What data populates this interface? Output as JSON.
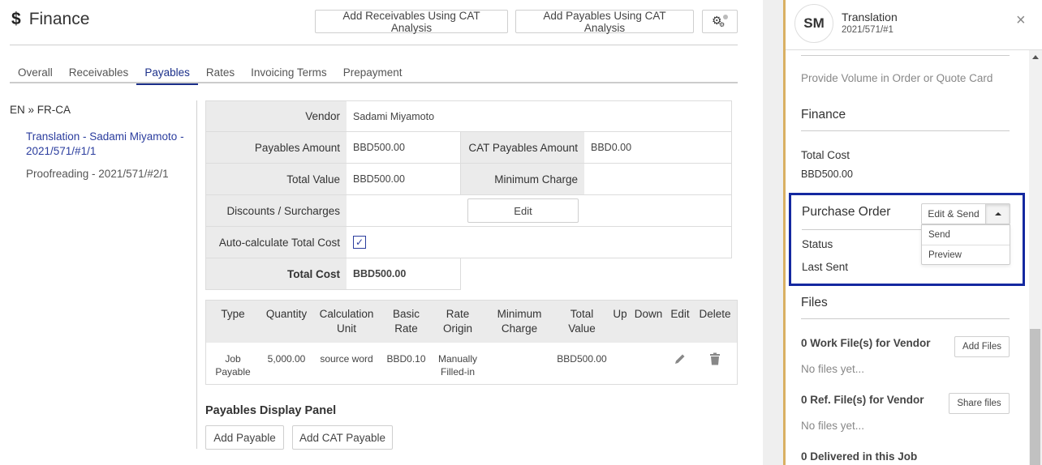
{
  "header": {
    "icon": "dollar-icon",
    "title": "Finance",
    "buttons": {
      "add_receivables_cat": "Add Receivables Using CAT Analysis",
      "add_payables_cat": "Add Payables Using CAT Analysis",
      "settings_icon": "gear-icon"
    }
  },
  "tabs": [
    {
      "label": "Overall",
      "active": false
    },
    {
      "label": "Receivables",
      "active": false
    },
    {
      "label": "Payables",
      "active": true
    },
    {
      "label": "Rates",
      "active": false
    },
    {
      "label": "Invoicing Terms",
      "active": false
    },
    {
      "label": "Prepayment",
      "active": false
    }
  ],
  "language_pair": "EN » FR-CA",
  "jobs": [
    {
      "label": "Translation - Sadami Miyamoto - 2021/571/#1/1",
      "active": true
    },
    {
      "label": "Proofreading - 2021/571/#2/1",
      "active": false
    }
  ],
  "form": {
    "vendor_label": "Vendor",
    "vendor_value": "Sadami Miyamoto",
    "payables_amount_label": "Payables Amount",
    "payables_amount_value": "BBD500.00",
    "cat_payables_amount_label": "CAT Payables Amount",
    "cat_payables_amount_value": "BBD0.00",
    "total_value_label": "Total Value",
    "total_value_value": "BBD500.00",
    "minimum_charge_label": "Minimum Charge",
    "minimum_charge_value": "",
    "discounts_label": "Discounts / Surcharges",
    "discounts_edit_button": "Edit",
    "auto_calc_label": "Auto-calculate Total Cost",
    "auto_calc_checked": true,
    "auto_calc_check_glyph": "✓",
    "total_cost_label": "Total Cost",
    "total_cost_value": "BBD500.00"
  },
  "items_table": {
    "headers": [
      "Type",
      "Quantity",
      "Calculation Unit",
      "Basic Rate",
      "Rate Origin",
      "Minimum Charge",
      "Total Value",
      "Up",
      "Down",
      "Edit",
      "Delete"
    ],
    "rows": [
      {
        "type": "Job Payable",
        "quantity": "5,000.00",
        "calculation_unit": "source word",
        "basic_rate": "BBD0.10",
        "rate_origin": "Manually Filled-in",
        "minimum_charge": "",
        "total_value": "BBD500.00",
        "edit_icon": "pencil-icon",
        "delete_icon": "trash-icon"
      }
    ]
  },
  "payables_panel": {
    "title": "Payables Display Panel",
    "add_payable": "Add Payable",
    "add_cat_payable": "Add CAT Payable"
  },
  "side_panel": {
    "avatar_initials": "SM",
    "title": "Translation",
    "subtitle": "2021/571/#1",
    "close_glyph": "×",
    "volume_hint": "Provide Volume in Order or Quote Card",
    "finance": {
      "heading": "Finance",
      "total_cost_label": "Total Cost",
      "total_cost_value": "BBD500.00"
    },
    "purchase_order": {
      "heading": "Purchase Order",
      "split_button": "Edit & Send",
      "dropdown_items": [
        "Send",
        "Preview"
      ],
      "status_label": "Status",
      "last_sent_label": "Last Sent"
    },
    "files": {
      "heading": "Files",
      "work_files_label": "0 Work File(s) for Vendor",
      "work_files_button": "Add Files",
      "work_files_empty": "No files yet...",
      "ref_files_label": "0 Ref. File(s) for Vendor",
      "ref_files_button": "Share files",
      "ref_files_empty": "No files yet...",
      "delivered_label": "0 Delivered in this Job"
    }
  },
  "colors": {
    "accent": "#1b2f8a",
    "side_border": "#d9b063",
    "highlight_box": "#1428a0"
  }
}
